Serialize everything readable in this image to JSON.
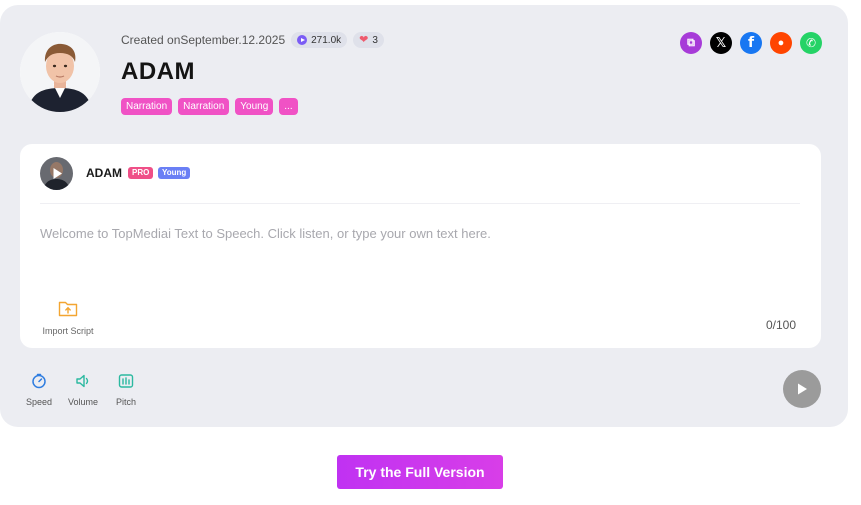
{
  "voice": {
    "created_prefix": "Created on",
    "created_date": "September.12.2025",
    "plays": "271.0k",
    "likes": "3",
    "name": "ADAM",
    "tags": [
      "Narration",
      "Narration",
      "Young",
      "..."
    ]
  },
  "share": {
    "icons": [
      "copy-link-icon",
      "x-twitter-icon",
      "facebook-icon",
      "reddit-icon",
      "whatsapp-icon"
    ],
    "copy_glyph": "⧉",
    "x_glyph": "𝕏",
    "facebook_glyph": "f",
    "reddit_glyph": "●",
    "whatsapp_glyph": "✆"
  },
  "editor": {
    "voice_name": "ADAM",
    "badge_pro": "PRO",
    "badge_young": "Young",
    "placeholder": "Welcome to TopMediai Text to Speech. Click listen, or type your own text here.",
    "import_label": "Import Script",
    "counter": "0/100"
  },
  "controls": {
    "speed": "Speed",
    "volume": "Volume",
    "pitch": "Pitch"
  },
  "cta": {
    "label": "Try the Full Version"
  },
  "colors": {
    "tag_pink": "#f052c5",
    "cta_purple": "#c032f2",
    "panel_bg": "#ecedf2",
    "control_blue": "#2f7de0",
    "control_green": "#2bb9a0",
    "import_orange": "#f3a531"
  }
}
